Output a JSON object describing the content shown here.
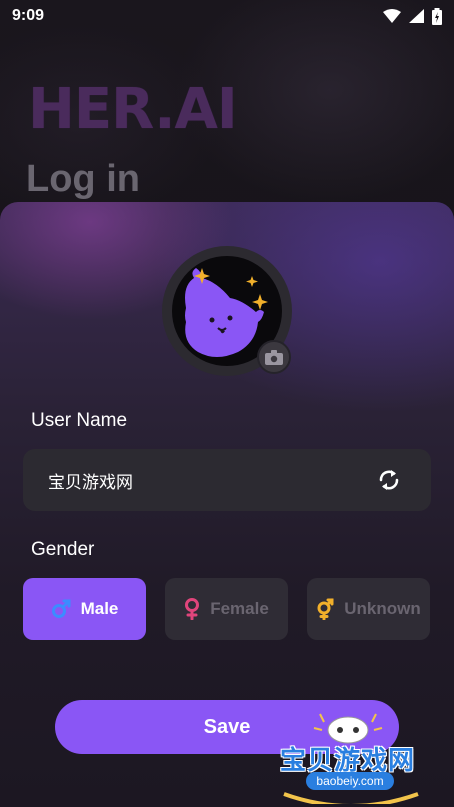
{
  "status_bar": {
    "time": "9:09"
  },
  "header": {
    "brand": "HER.AI",
    "title": "Log in"
  },
  "profile": {
    "avatar_icon": "purple-monster-avatar",
    "camera_icon": "camera-icon"
  },
  "username": {
    "label": "User Name",
    "value": "宝贝游戏网",
    "refresh_icon": "refresh-icon"
  },
  "gender": {
    "label": "Gender",
    "options": [
      {
        "label": "Male",
        "icon": "male-icon",
        "selected": true,
        "icon_color": "#3b8cff"
      },
      {
        "label": "Female",
        "icon": "female-icon",
        "selected": false,
        "icon_color": "#e0457b"
      },
      {
        "label": "Unknown",
        "icon": "genderqueer-icon",
        "selected": false,
        "icon_color": "#f2b02b"
      }
    ]
  },
  "actions": {
    "save_label": "Save"
  },
  "watermark": {
    "text": "宝贝游戏网",
    "url": "baobeiy.com"
  },
  "colors": {
    "accent": "#8a56f5",
    "field_bg": "#2c2a31"
  }
}
